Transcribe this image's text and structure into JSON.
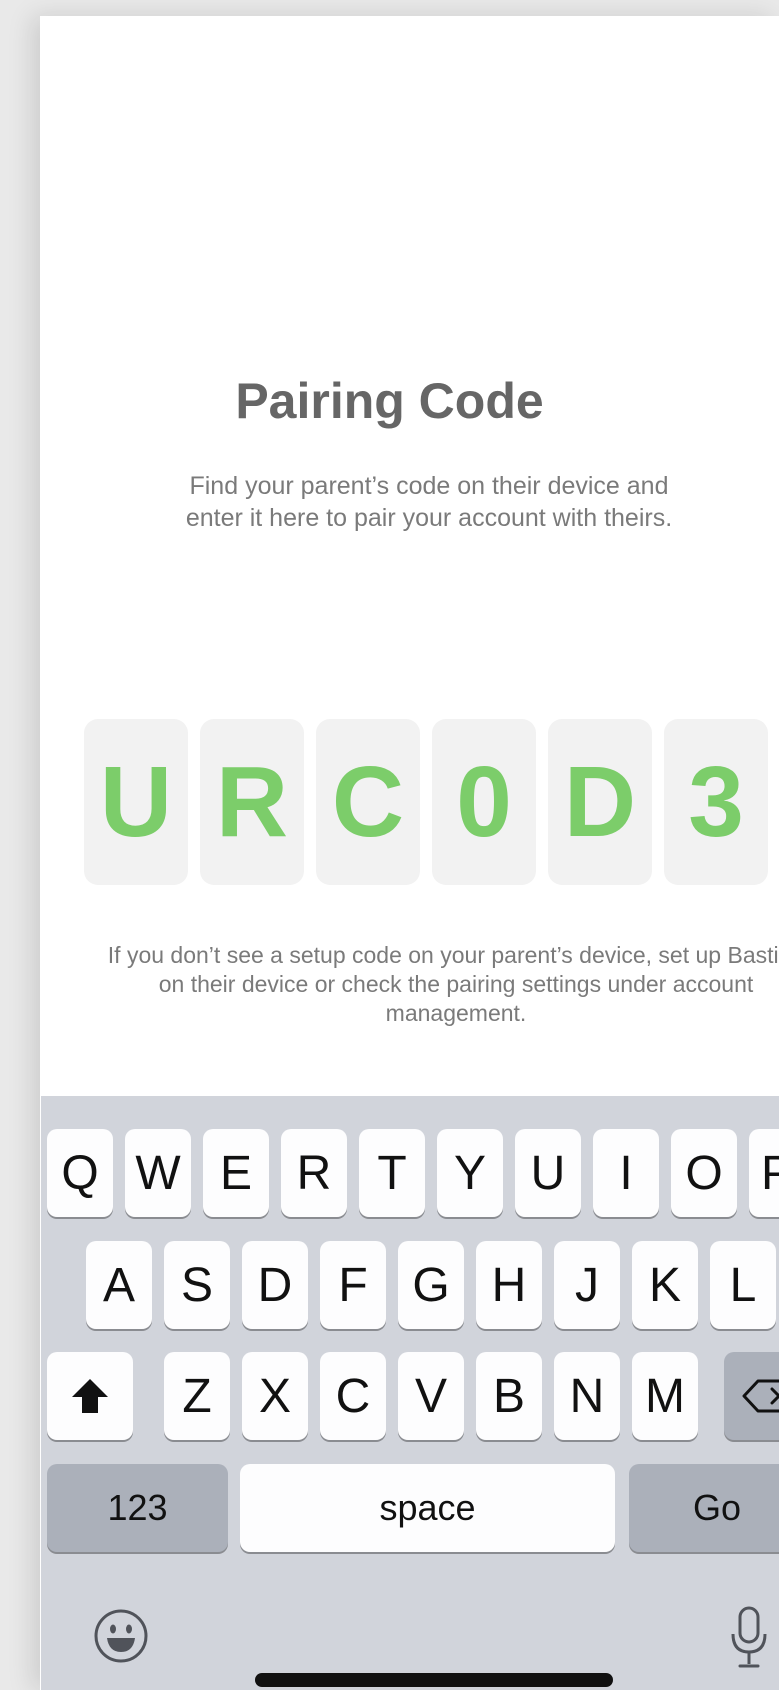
{
  "screen": {
    "title": "Pairing Code",
    "subtitle": "Find your parent’s code on their device and enter it here to pair your account with theirs.",
    "note": "If you don’t see a setup code on your parent’s device, set up Bastion on their device or check the pairing settings under account management.",
    "accent_color": "#7ccd6a"
  },
  "code": {
    "chars": [
      "U",
      "R",
      "C",
      "0",
      "D",
      "3"
    ]
  },
  "keyboard": {
    "row1": [
      "Q",
      "W",
      "E",
      "R",
      "T",
      "Y",
      "U",
      "I",
      "O",
      "P"
    ],
    "row2": [
      "A",
      "S",
      "D",
      "F",
      "G",
      "H",
      "J",
      "K",
      "L"
    ],
    "row3": [
      "Z",
      "X",
      "C",
      "V",
      "B",
      "N",
      "M"
    ],
    "numbers_label": "123",
    "space_label": "space",
    "go_label": "Go",
    "icons": [
      "shift-icon",
      "backspace-icon",
      "emoji-icon",
      "microphone-icon"
    ]
  }
}
